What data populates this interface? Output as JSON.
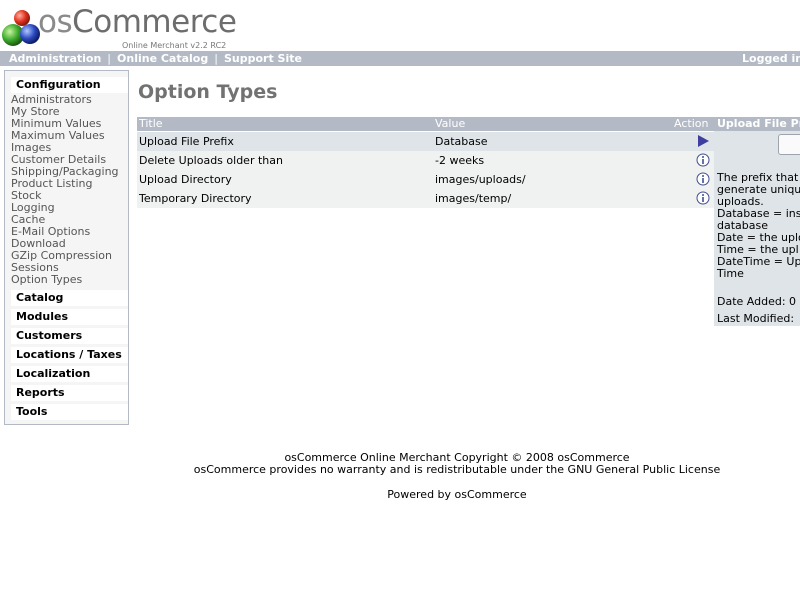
{
  "header": {
    "logo_text_os": "os",
    "logo_text_commerce": "Commerce",
    "logo_subtitle": "Online Merchant v2.2 RC2"
  },
  "topnav": {
    "administration": "Administration",
    "online_catalog": "Online Catalog",
    "support_site": "Support Site",
    "separator": "|",
    "logged_in": "Logged in a"
  },
  "sidebar": {
    "configuration": {
      "title": "Configuration",
      "items": [
        "Administrators",
        "My Store",
        "Minimum Values",
        "Maximum Values",
        "Images",
        "Customer Details",
        "Shipping/Packaging",
        "Product Listing",
        "Stock",
        "Logging",
        "Cache",
        "E-Mail Options",
        "Download",
        "GZip Compression",
        "Sessions",
        "Option Types"
      ]
    },
    "catalog": "Catalog",
    "modules": "Modules",
    "customers": "Customers",
    "locations_taxes": "Locations / Taxes",
    "localization": "Localization",
    "reports": "Reports",
    "tools": "Tools"
  },
  "main": {
    "title": "Option Types",
    "table": {
      "headers": {
        "title": "Title",
        "value": "Value",
        "action": "Action"
      },
      "rows": [
        {
          "title": "Upload File Prefix",
          "value": "Database",
          "action_icon": "arrow-right-icon"
        },
        {
          "title": "Delete Uploads older than",
          "value": "-2 weeks",
          "action_icon": "info-icon"
        },
        {
          "title": "Upload Directory",
          "value": "images/uploads/",
          "action_icon": "info-icon"
        },
        {
          "title": "Temporary Directory",
          "value": "images/temp/",
          "action_icon": "info-icon"
        }
      ]
    }
  },
  "infobox": {
    "title": "Upload File Pre",
    "description_lines": [
      "The prefix that",
      "generate uniqu",
      "uploads.",
      "Database = ins",
      "database",
      "Date = the uplo",
      "Time = the upl",
      "DateTime = Up",
      "Time"
    ],
    "date_added": "Date Added: 0",
    "last_modified": "Last Modified:"
  },
  "footer": {
    "copyright": "osCommerce Online Merchant Copyright © 2008 osCommerce",
    "license": "osCommerce provides no warranty and is redistributable under the GNU General Public License",
    "powered_by": "Powered by osCommerce"
  },
  "colors": {
    "nav_bar": "#b3bac5",
    "row_bg": "#f0f1f1",
    "selected_row_bg": "#dee4e8",
    "title_gray": "#727272",
    "arrow_icon": "#3f3fa0"
  }
}
